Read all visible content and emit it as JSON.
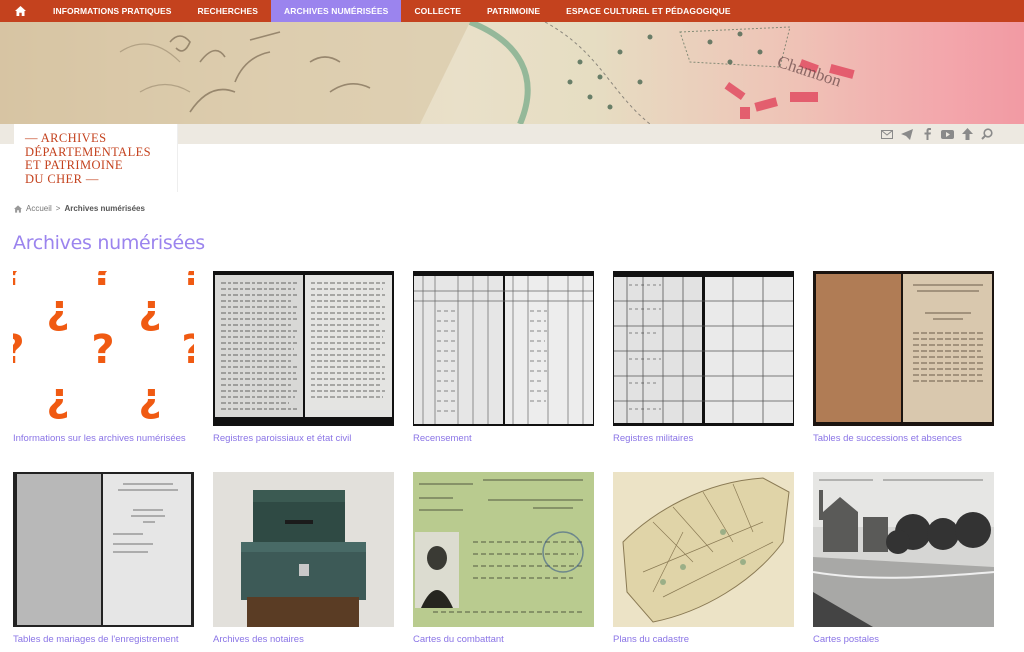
{
  "nav": {
    "home_icon": "home-icon",
    "items": [
      {
        "label": "INFORMATIONS PRATIQUES",
        "active": false
      },
      {
        "label": "RECHERCHES",
        "active": false
      },
      {
        "label": "ARCHIVES NUMÉRISÉES",
        "active": true
      },
      {
        "label": "COLLECTE",
        "active": false
      },
      {
        "label": "PATRIMOINE",
        "active": false
      },
      {
        "label": "ESPACE CULTUREL ET PÉDAGOGIQUE",
        "active": false
      }
    ],
    "colors": {
      "bar": "#c4421e",
      "active": "#9b84ee"
    }
  },
  "banner": {
    "handwriting": "Chambon"
  },
  "logo": {
    "line1": "— ARCHIVES",
    "line2": "DÉPARTEMENTALES",
    "line3": "ET PATRIMOINE",
    "line4": "DU CHER —"
  },
  "social_icons": [
    "mail-icon",
    "send-icon",
    "facebook-icon",
    "youtube-icon",
    "up-arrow-icon",
    "search-icon"
  ],
  "breadcrumb": {
    "home": "Accueil",
    "current": "Archives numérisées"
  },
  "page_title": "Archives numérisées",
  "cards": [
    {
      "label": "Informations sur les archives numérisées"
    },
    {
      "label": "Registres paroissiaux et état civil"
    },
    {
      "label": "Recensement"
    },
    {
      "label": "Registres militaires"
    },
    {
      "label": "Tables de successions et absences"
    },
    {
      "label": "Tables de mariages de l'enregistrement"
    },
    {
      "label": "Archives des notaires"
    },
    {
      "label": "Cartes du combattant"
    },
    {
      "label": "Plans du cadastre"
    },
    {
      "label": "Cartes postales"
    }
  ],
  "colors": {
    "accent": "#9b84ee",
    "brand": "#c4421e",
    "orange": "#f05a12"
  }
}
